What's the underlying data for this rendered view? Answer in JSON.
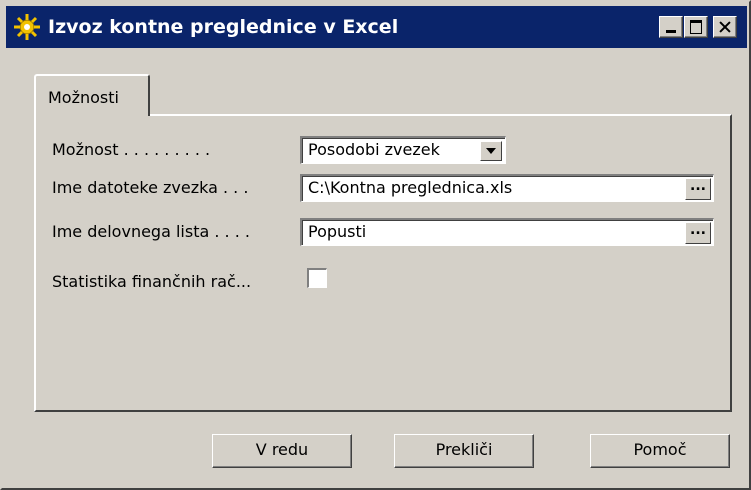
{
  "window": {
    "title": "Izvoz kontne preglednice v Excel",
    "title_bar_color": "#0a246a",
    "icon": "gear-star-icon"
  },
  "tabs": [
    {
      "label": "Možnosti",
      "active": true
    }
  ],
  "fields": {
    "option": {
      "label": "Možnost . . . . . . . . .",
      "value": "Posodobi zvezek"
    },
    "workbook_file": {
      "label": "Ime datoteke zvezka . . .",
      "value": "C:\\Kontna preglednica.xls",
      "button": "..."
    },
    "worksheet": {
      "label": "Ime delovnega lista . . . .",
      "value": "Popusti",
      "button": "..."
    },
    "stats": {
      "label": "Statistika finančnih rač...",
      "checked": false
    }
  },
  "buttons": {
    "ok": "V redu",
    "cancel": "Prekliči",
    "help": "Pomoč"
  }
}
